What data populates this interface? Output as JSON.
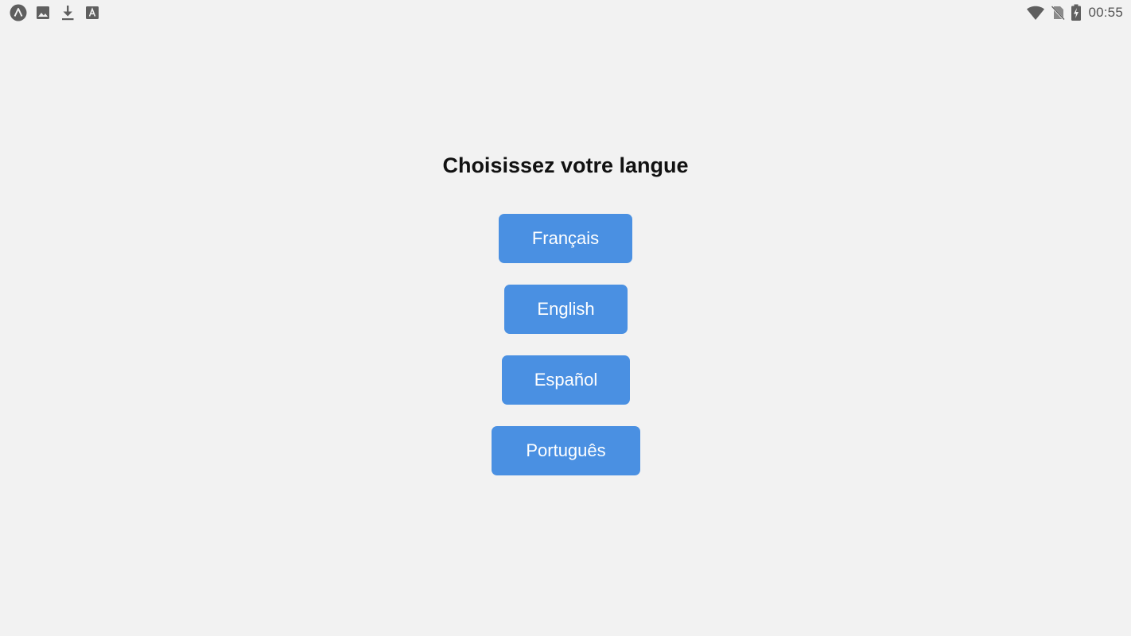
{
  "status_bar": {
    "left_icons": [
      "app-logo-icon",
      "image-icon",
      "download-icon",
      "font-icon"
    ],
    "right_icons": [
      "wifi-icon",
      "no-sim-icon",
      "battery-charging-icon"
    ],
    "time": "00:55"
  },
  "main": {
    "title": "Choisissez votre langue",
    "languages": [
      {
        "label": "Français"
      },
      {
        "label": "English"
      },
      {
        "label": "Español"
      },
      {
        "label": "Português"
      }
    ]
  },
  "colors": {
    "background": "#f2f2f2",
    "button": "#4a90e2",
    "button_text": "#ffffff",
    "title_text": "#111111"
  }
}
